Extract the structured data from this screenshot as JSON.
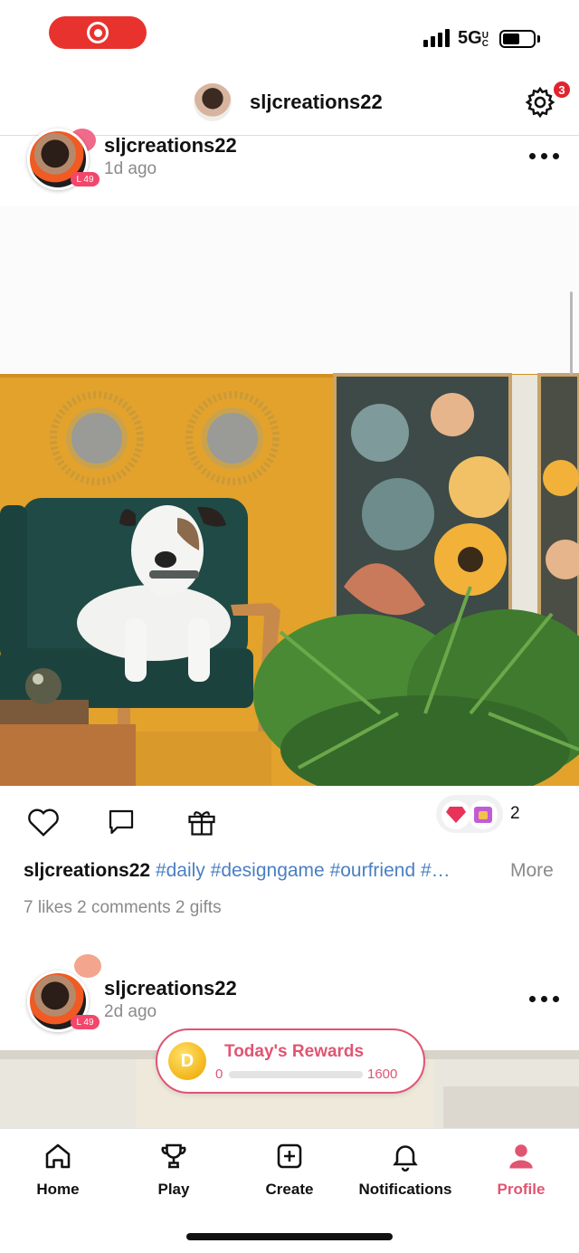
{
  "status_bar": {
    "network": "5G",
    "network_suffix": "UC",
    "battery_level": 0.55
  },
  "header": {
    "username": "sljcreations22",
    "settings_badge": "3"
  },
  "posts": [
    {
      "username": "sljcreations22",
      "time": "1d ago",
      "level": "L 49",
      "gift_count": "2",
      "caption_user": "sljcreations22",
      "caption_tags": "#daily #designgame #ourfriend #…",
      "more_label": "More",
      "stats": "7 likes 2 comments 2 gifts"
    },
    {
      "username": "sljcreations22",
      "time": "2d ago",
      "level": "L 49"
    }
  ],
  "rewards": {
    "title": "Today's Rewards",
    "min": "0",
    "max": "1600",
    "progress": 0
  },
  "tabs": [
    {
      "label": "Home",
      "icon": "home-icon"
    },
    {
      "label": "Play",
      "icon": "trophy-icon"
    },
    {
      "label": "Create",
      "icon": "create-icon"
    },
    {
      "label": "Notifications",
      "icon": "bell-icon"
    },
    {
      "label": "Profile",
      "icon": "person-icon",
      "active": true
    }
  ],
  "colors": {
    "accent": "#e05572",
    "hashtag": "#4a7fc1",
    "record": "#e8322e",
    "wall": "#e3a22b",
    "sofa": "#1f4a45"
  }
}
